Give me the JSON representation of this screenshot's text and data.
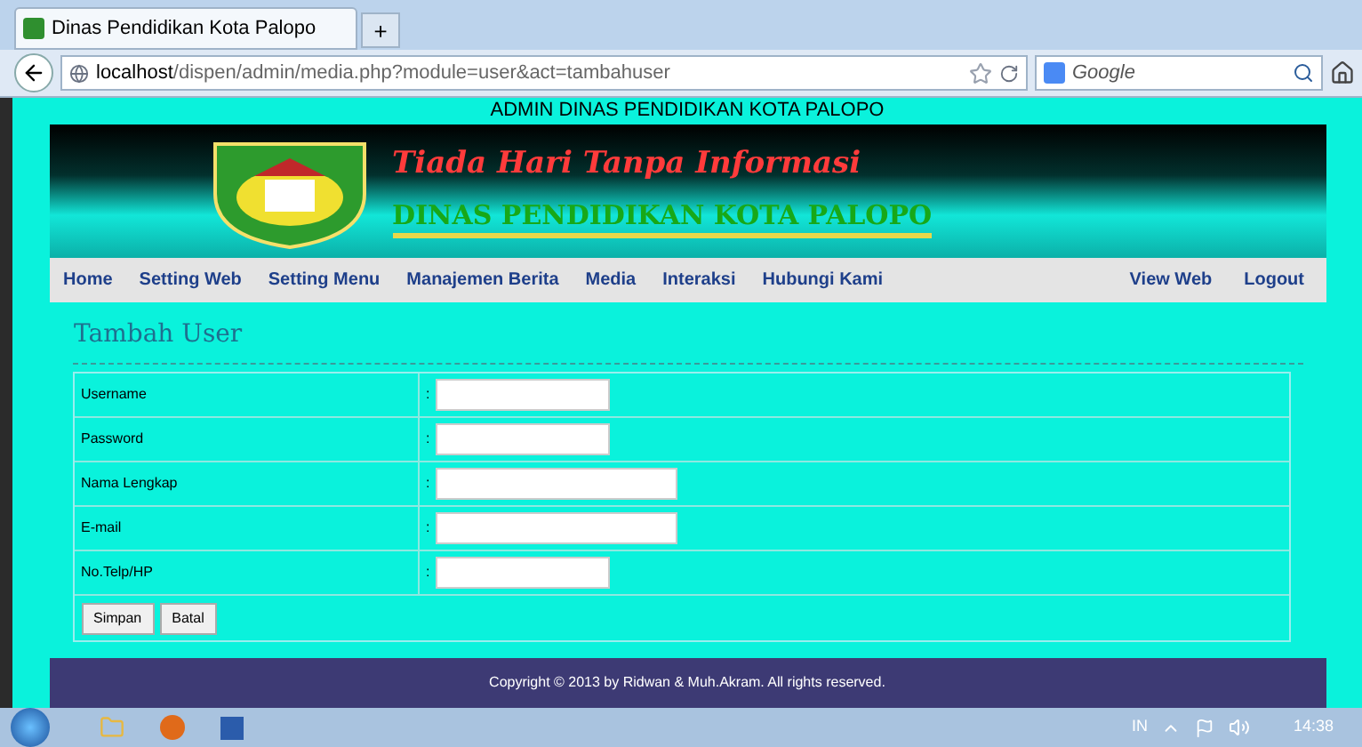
{
  "browser": {
    "tab_title": "Dinas Pendidikan Kota Palopo",
    "new_tab": "+",
    "url_host": "localhost",
    "url_path": "/dispen/admin/media.php?module=user&act=tambahuser",
    "search_placeholder": "Google"
  },
  "page": {
    "top_title": "ADMIN DINAS PENDIDIKAN KOTA PALOPO",
    "banner_slogan": "Tiada Hari Tanpa Informasi",
    "banner_title": "DINAS PENDIDIKAN KOTA PALOPO",
    "nav_left": [
      "Home",
      "Setting Web",
      "Setting Menu",
      "Manajemen Berita",
      "Media",
      "Interaksi",
      "Hubungi Kami"
    ],
    "nav_right": [
      "View Web",
      "Logout"
    ],
    "heading": "Tambah User",
    "fields": [
      {
        "label": "Username",
        "separator": ":",
        "wide": false
      },
      {
        "label": "Password",
        "separator": ":",
        "wide": false
      },
      {
        "label": "Nama Lengkap",
        "separator": ":",
        "wide": true
      },
      {
        "label": "E-mail",
        "separator": ":",
        "wide": true
      },
      {
        "label": "No.Telp/HP",
        "separator": ":",
        "wide": false
      }
    ],
    "buttons": [
      "Simpan",
      "Batal"
    ],
    "footer": "Copyright © 2013 by Ridwan & Muh.Akram. All rights reserved."
  },
  "taskbar": {
    "language": "IN",
    "clock": "14:38"
  }
}
